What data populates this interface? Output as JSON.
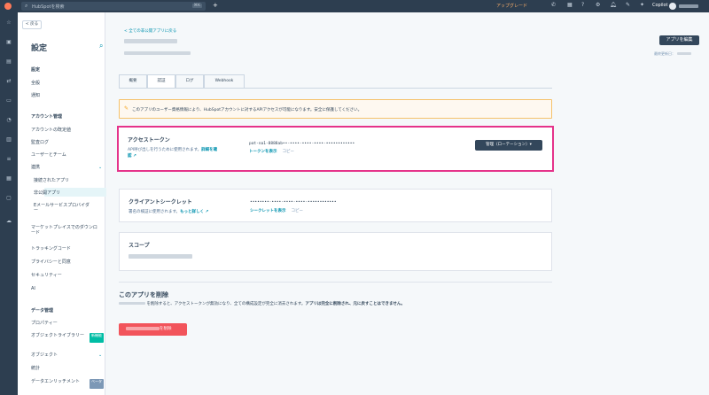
{
  "topbar": {
    "search_placeholder": "HubSpotを検索",
    "search_shortcut": "⌘K",
    "upgrade": "アップグレード",
    "copilot": "Copilot"
  },
  "settings": {
    "back": "< 戻る",
    "title": "設定",
    "sections": [
      {
        "label": "設定"
      },
      {
        "label": "全般"
      },
      {
        "label": "通知"
      }
    ],
    "account_heading": "アカウント管理",
    "account_items": [
      "アカウントの既定値",
      "監査ログ",
      "ユーザーとチーム",
      "連携"
    ],
    "integration_items": [
      "接続されたアプリ",
      "非公開アプリ",
      "Eメールサービスプロバイダー"
    ],
    "more_items": [
      "マーケットプレイスでのダウンロード",
      "トラッキングコード",
      "プライバシーと同意",
      "セキュリティー",
      "AI"
    ],
    "data_heading": "データ管理",
    "data_items": [
      "プロパティー",
      "オブジェクトライブラリー",
      "オブジェクト",
      "統計",
      "データエンリッチメント"
    ],
    "badge_new": "新機能",
    "badge_beta": "ベータ"
  },
  "main": {
    "breadcrumb": "< 全ての非公開アプリに戻る",
    "edit_button": "アプリを編集",
    "updated_label": "最終更新日：",
    "tabs": [
      "概要",
      "認証",
      "ログ",
      "Webhook"
    ],
    "active_tab": "認証",
    "notice": "このアプリのユーザー資格情報により、HubSpotアカウントに対するAPIアクセスが可能になります。安全に保護してください。",
    "access_token": {
      "title": "アクセストークン",
      "desc": "API呼び出しを行うために使用されます。",
      "desc_link": "詳細を確認",
      "value": "pat-na1-8888ab••-••••-••••-••••-••••••••••••",
      "show": "トークンを表示",
      "copy": "コピー",
      "rotate": "管理（ローテーション）▾"
    },
    "client_secret": {
      "title": "クライアントシークレット",
      "desc": "署名の検証に使用されます。",
      "desc_link": "もっと詳しく",
      "value": "••••••••-••••-••••-••••-••••••••••••",
      "show": "シークレットを表示",
      "copy": "コピー"
    },
    "scope": {
      "title": "スコープ"
    },
    "delete": {
      "title": "このアプリを削除",
      "desc_1": "を削除すると、アクセストークンが無効になり、全ての構成設定が完全に消去されます。",
      "desc_bold": "アプリは完全に削除され、元に戻すことはできません。",
      "button": "を削除"
    }
  }
}
